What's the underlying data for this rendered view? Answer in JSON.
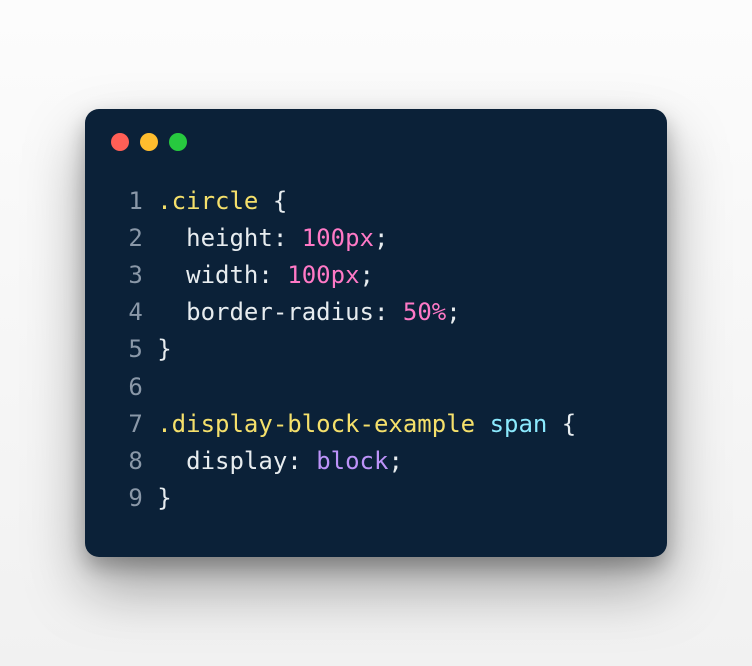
{
  "window": {
    "dots": [
      "red",
      "yellow",
      "green"
    ]
  },
  "code": {
    "lines": [
      {
        "n": "1",
        "tokens": [
          {
            "cls": "tok-sel",
            "t": ".circle"
          },
          {
            "cls": "tok-punc",
            "t": " {"
          }
        ]
      },
      {
        "n": "2",
        "tokens": [
          {
            "cls": "tok-punc",
            "t": "  "
          },
          {
            "cls": "tok-prop",
            "t": "height"
          },
          {
            "cls": "tok-punc",
            "t": ": "
          },
          {
            "cls": "tok-num",
            "t": "100px"
          },
          {
            "cls": "tok-punc",
            "t": ";"
          }
        ]
      },
      {
        "n": "3",
        "tokens": [
          {
            "cls": "tok-punc",
            "t": "  "
          },
          {
            "cls": "tok-prop",
            "t": "width"
          },
          {
            "cls": "tok-punc",
            "t": ": "
          },
          {
            "cls": "tok-num",
            "t": "100px"
          },
          {
            "cls": "tok-punc",
            "t": ";"
          }
        ]
      },
      {
        "n": "4",
        "tokens": [
          {
            "cls": "tok-punc",
            "t": "  "
          },
          {
            "cls": "tok-prop",
            "t": "border-radius"
          },
          {
            "cls": "tok-punc",
            "t": ": "
          },
          {
            "cls": "tok-num",
            "t": "50%"
          },
          {
            "cls": "tok-punc",
            "t": ";"
          }
        ]
      },
      {
        "n": "5",
        "tokens": [
          {
            "cls": "tok-punc",
            "t": "}"
          }
        ]
      },
      {
        "n": "6",
        "tokens": [
          {
            "cls": "tok-punc",
            "t": ""
          }
        ]
      },
      {
        "n": "7",
        "tokens": [
          {
            "cls": "tok-sel",
            "t": ".display-block-example"
          },
          {
            "cls": "tok-punc",
            "t": " "
          },
          {
            "cls": "tok-tag",
            "t": "span"
          },
          {
            "cls": "tok-punc",
            "t": " {"
          }
        ]
      },
      {
        "n": "8",
        "tokens": [
          {
            "cls": "tok-punc",
            "t": "  "
          },
          {
            "cls": "tok-prop",
            "t": "display"
          },
          {
            "cls": "tok-punc",
            "t": ": "
          },
          {
            "cls": "tok-kw",
            "t": "block"
          },
          {
            "cls": "tok-punc",
            "t": ";"
          }
        ]
      },
      {
        "n": "9",
        "tokens": [
          {
            "cls": "tok-punc",
            "t": "}"
          }
        ]
      }
    ]
  }
}
